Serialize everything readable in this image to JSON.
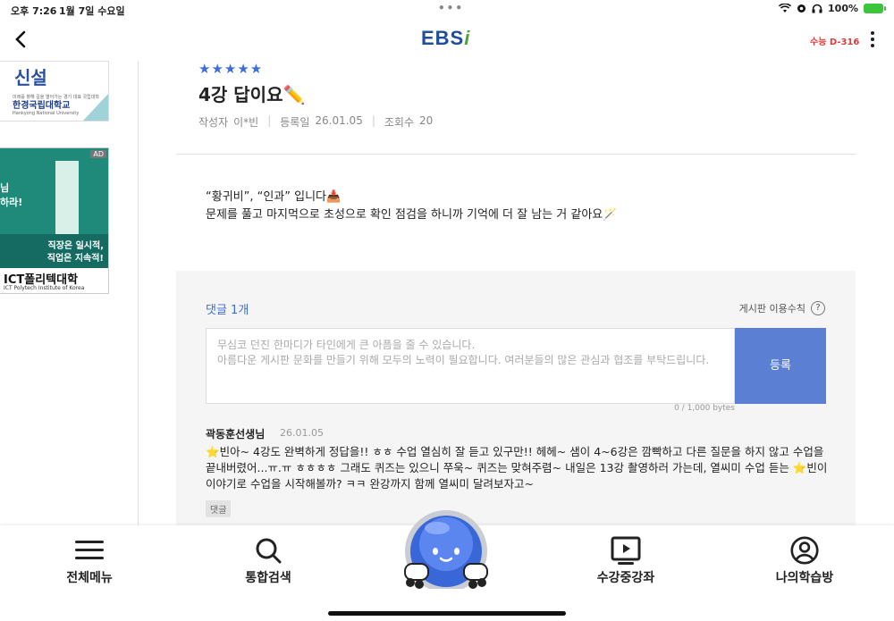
{
  "status_bar": {
    "time": "오후 7:26",
    "date": "1월 7일 수요일",
    "battery": "100%"
  },
  "header": {
    "logo_text": "EBS",
    "logo_suffix": "i",
    "dday": "수능 D-316"
  },
  "ads": {
    "ad1": {
      "headline": "신설",
      "small_text": "미래를 향해 길을 열어가는 경기 대표 국립대학",
      "university": "한경국립대학교",
      "university_en": "Hankyong National University"
    },
    "ad2": {
      "tag": "AD",
      "text_left": "님\n하라!",
      "line1": "직장은 일시적,",
      "line2": "직업은 지속적!",
      "brand": "ICT폴리텍대학",
      "brand_en": "ICT Polytech Institute of Korea"
    }
  },
  "post": {
    "stars": "★★★★★",
    "title": "4강 답이요✏️",
    "author_label": "작성자",
    "author": "이*빈",
    "date_label": "등록일",
    "date": "26.01.05",
    "views_label": "조회수",
    "views": "20",
    "body_line1": "“황귀비”, “인과” 입니다📥",
    "body_line2": "문제를 풀고 마지먹으로 초성으로 확인 점검을 하니까 기억에 더 잘 남는 거 같아요🪄"
  },
  "comments": {
    "count_label": "댓글 1개",
    "rules_label": "게시판 이용수칙",
    "rules_icon": "?",
    "placeholder": "무심코 던진 한마디가 타인에게 큰 아픔을 줄 수 있습니다.\n아름다운 게시판 문화를 만들기 위해 모두의 노력이 필요합니다. 여러분들의 많은 관심과 협조를 부탁드립니다.",
    "submit_label": "등록",
    "bytes": "0 / 1,000 bytes",
    "items": [
      {
        "author": "곽동훈선생님",
        "date": "26.01.05",
        "text": "⭐빈아~ 4강도 완벽하게 정답을!! ㅎㅎ 수업 열심히 잘 듣고 있구만!! 헤헤~ 샘이 4~6강은 깜빡하고 다른 질문을 하지 않고 수업을 끝내버렸어...ㅠ.ㅠ ㅎㅎㅎㅎ 그래도 퀴즈는 있으니 쭈욱~ 퀴즈는 맞혀주렴~ 내일은 13강 촬영하러 가는데, 열씨미 수업 듣는 ⭐빈이 이야기로 수업을 시작해볼까? ㅋㅋ 완강까지 함께 열씨미 달려보자고~",
        "reply_label": "댓글"
      }
    ]
  },
  "tabbar": {
    "menu": "전체메뉴",
    "search": "통합검색",
    "courses": "수강중강좌",
    "mystudy": "나의학습방"
  }
}
